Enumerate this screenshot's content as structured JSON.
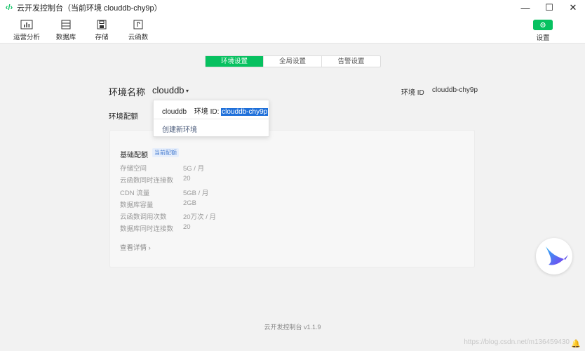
{
  "window": {
    "title": "云开发控制台（当前环境 clouddb-chy9p）",
    "app_icon": "‹/›",
    "minimize": "—",
    "maximize": "☐",
    "close": "✕"
  },
  "toolbar": {
    "items": [
      {
        "label": "运营分析",
        "icon": "bar-chart-icon"
      },
      {
        "label": "数据库",
        "icon": "database-icon"
      },
      {
        "label": "存储",
        "icon": "storage-icon"
      },
      {
        "label": "云函数",
        "icon": "cloud-function-icon"
      }
    ],
    "settings_label": "设置",
    "settings_icon": "gear-icon"
  },
  "tabs": [
    {
      "label": "环境设置",
      "active": true
    },
    {
      "label": "全局设置",
      "active": false
    },
    {
      "label": "告警设置",
      "active": false
    }
  ],
  "env": {
    "label": "环境名称",
    "selected": "clouddb",
    "caret": "▾",
    "id_label": "环境 ID",
    "id_value": "clouddb-chy9p"
  },
  "dropdown": {
    "item_name": "clouddb",
    "item_id_label": "环境 ID:",
    "item_id_value": "clouddb-chy9p",
    "create_label": "创建新环境"
  },
  "quota": {
    "section_label": "环境配额",
    "card_title": "基础配额",
    "badge": "当前配额",
    "rows": [
      {
        "k": "存储空间",
        "v": "5G / 月"
      },
      {
        "k": "云函数同时连接数",
        "v": "20"
      },
      {
        "k": "CDN 流量",
        "v": "5GB / 月"
      },
      {
        "k": "数据库容量",
        "v": "2GB"
      },
      {
        "k": "云函数调用次数",
        "v": "20万次 / 月"
      },
      {
        "k": "数据库同时连接数",
        "v": "20"
      }
    ],
    "details_label": "查看详情 ›"
  },
  "footer": "云开发控制台 v1.1.9",
  "watermark": "https://blog.csdn.net/m136459430",
  "colors": {
    "accent": "#07c160",
    "selection": "#1e6fd9"
  }
}
